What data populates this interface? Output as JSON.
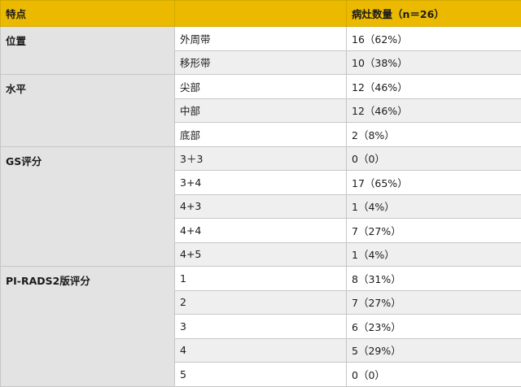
{
  "header": {
    "col1": "特点",
    "col2": "",
    "col3": "病灶数量（n＝26）"
  },
  "groups": [
    {
      "label": "位置",
      "rows": [
        {
          "item": "外周带",
          "value": "16（62%）"
        },
        {
          "item": "移形带",
          "value": "10（38%）"
        }
      ]
    },
    {
      "label": "水平",
      "rows": [
        {
          "item": "尖部",
          "value": "12（46%）"
        },
        {
          "item": "中部",
          "value": "12（46%）"
        },
        {
          "item": "底部",
          "value": "2（8%）"
        }
      ]
    },
    {
      "label": "GS评分",
      "rows": [
        {
          "item": "3＋3",
          "value": "0（0）"
        },
        {
          "item": "3+4",
          "value": "17（65%）"
        },
        {
          "item": "4+3",
          "value": "1（4%）"
        },
        {
          "item": "4+4",
          "value": "7（27%）"
        },
        {
          "item": "4+5",
          "value": "1（4%）"
        }
      ]
    },
    {
      "label": "PI-RADS2版评分",
      "rows": [
        {
          "item": "1",
          "value": "8（31%）"
        },
        {
          "item": "2",
          "value": "7（27%）"
        },
        {
          "item": "3",
          "value": "6（23%）"
        },
        {
          "item": "4",
          "value": "5（29%）"
        },
        {
          "item": "5",
          "value": "0（0）"
        }
      ]
    }
  ],
  "colors": {
    "header_bg": "#eab900",
    "group_bg": "#e3e3e3",
    "row_shade": "#efefef",
    "row_plain": "#ffffff",
    "border": "#c6c6c6"
  }
}
